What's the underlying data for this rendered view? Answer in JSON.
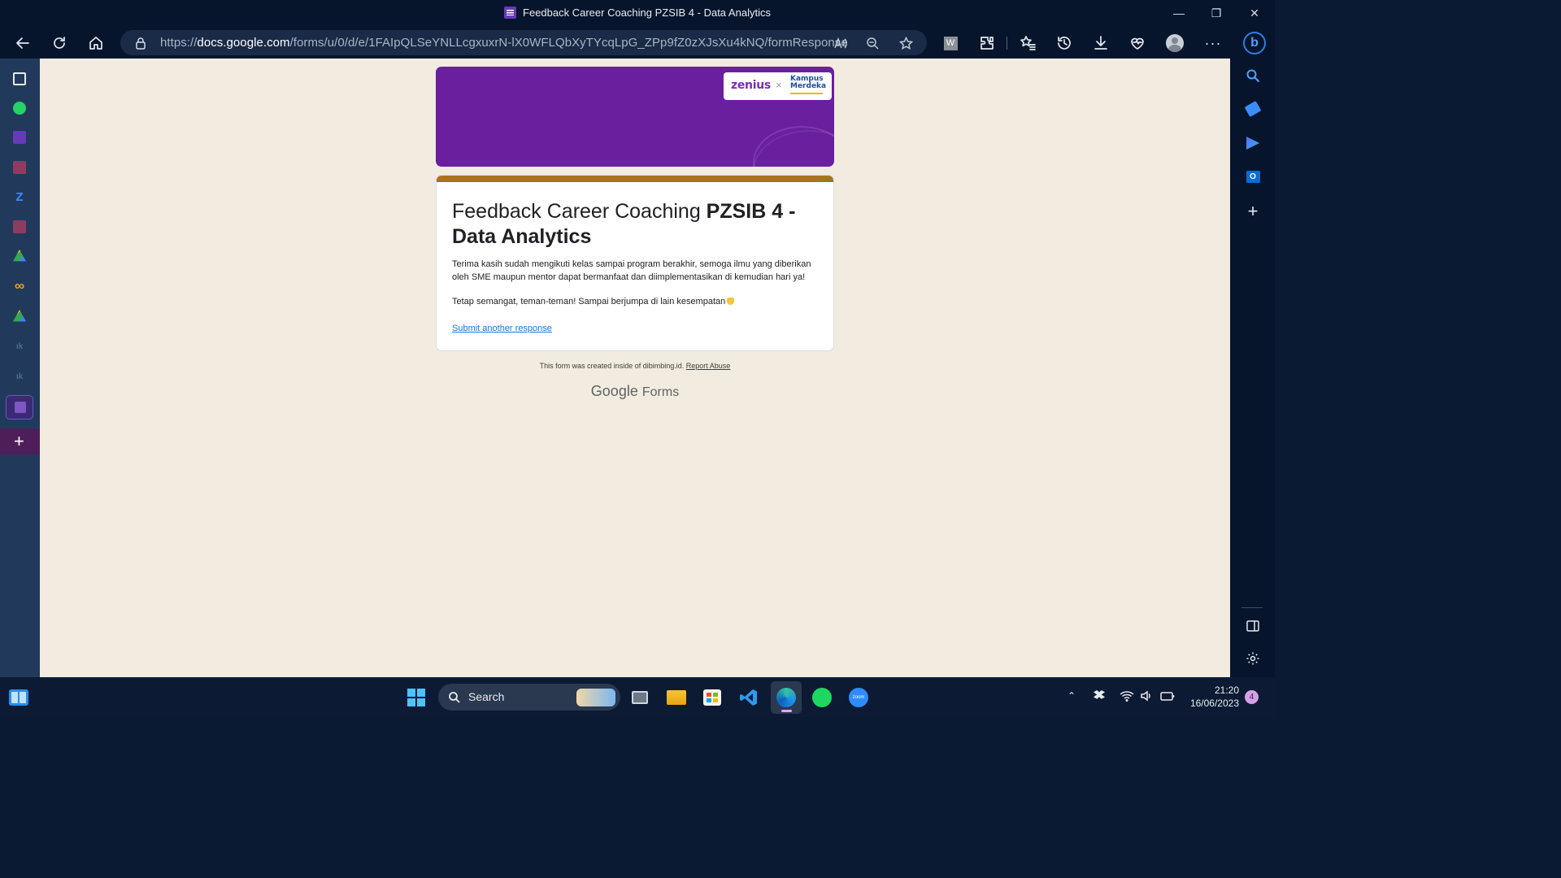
{
  "window": {
    "title": "Feedback Career Coaching PZSIB 4 - Data Analytics",
    "controls": [
      "minimize",
      "restore",
      "close"
    ]
  },
  "browser": {
    "url_prefix": "https://",
    "url_host": "docs.google.com",
    "url_path": "/forms/u/0/d/e/1FAIpQLSeYNLLcgxuxrN-lX0WFLQbXyTYcqLpG_ZPp9fZ0zXJsXu4kNQ/formResponse",
    "toolbar_icons": [
      "read-aloud-icon",
      "zoom-out-icon",
      "favorite-star-icon",
      "extension-w-icon",
      "extensions-icon",
      "favorites-icon",
      "history-icon",
      "downloads-icon",
      "performance-icon",
      "profile-icon",
      "more-icon",
      "bing-icon"
    ]
  },
  "left_tabs": [
    "tab-actions",
    "whatsapp",
    "google-forms",
    "pdf",
    "zenius",
    "pdf",
    "google-drive",
    "infinity",
    "google-drive",
    "ik",
    "ik",
    "google-forms-active"
  ],
  "right_sidebar": [
    "search",
    "shopping",
    "bing-chat",
    "outlook",
    "add"
  ],
  "form": {
    "banner_logo": {
      "brand": "zenius",
      "separator": "×",
      "partner_line1": "Kampus",
      "partner_line2": "Merdeka"
    },
    "title_regular": "Feedback Career Coaching ",
    "title_bold": "PZSIB 4 - Data Analytics",
    "message_1": "Terima kasih sudah mengikuti kelas sampai program berakhir, semoga ilmu yang diberikan oleh SME maupun mentor dapat bermanfaat dan diimplementasikan di kemudian hari ya!",
    "message_2": "Tetap semangat, teman-teman! Sampai berjumpa di lain kesempatan",
    "submit_another": "Submit another response",
    "footer_note": "This form was created inside of dibimbing.id.",
    "report_abuse": "Report Abuse",
    "google": "Google",
    "forms": "Forms"
  },
  "taskbar": {
    "search_label": "Search",
    "clock_time": "21:20",
    "clock_date": "16/06/2023",
    "notification_count": "4"
  },
  "colors": {
    "banner": "#6a1f9f",
    "card_accent": "#a6741b",
    "page_bg": "#f2ebdf",
    "link": "#1a73e8"
  }
}
